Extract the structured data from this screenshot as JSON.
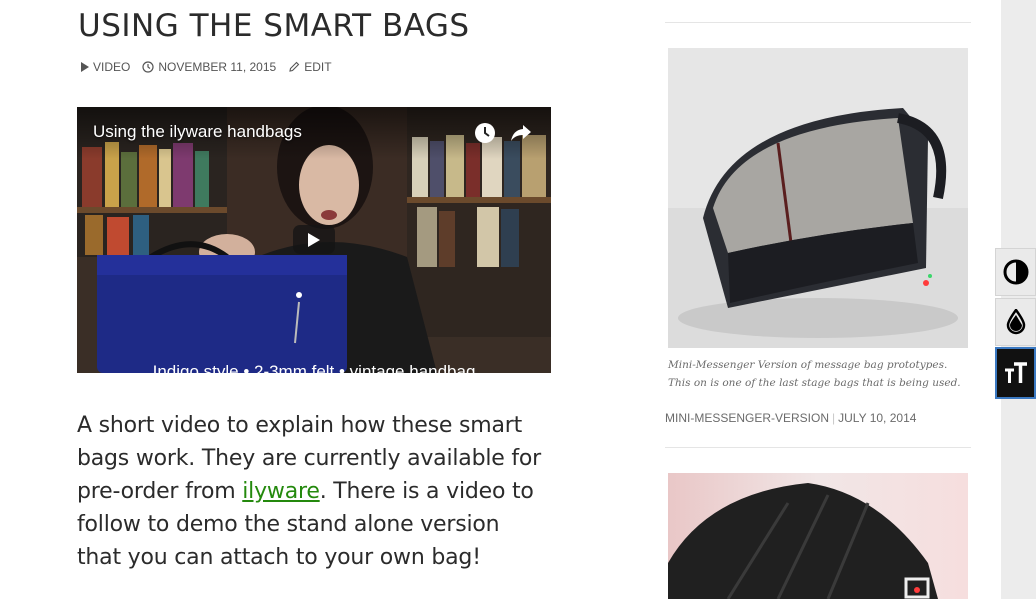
{
  "post": {
    "title": "USING THE SMART BAGS",
    "meta": {
      "format": "VIDEO",
      "date": "NOVEMBER 11, 2015",
      "edit": "EDIT"
    },
    "video": {
      "title": "Using the ilyware handbags",
      "caption": "Indigo style • 2-3mm felt • vintage handbag"
    },
    "body": {
      "before_link": "A short video to explain how these smart bags work. They are currently available for pre-order from ",
      "link_text": "ilyware",
      "after_link": ". There is a video to follow to demo the stand alone version that you can attach to your own bag!"
    }
  },
  "sidebar": {
    "post1": {
      "caption": "Mini-Messenger Version of message bag prototypes. This on is one of the last stage bags that is being used.",
      "category": "MINI-MESSENGER-VERSION",
      "separator": "|",
      "date": "JULY 10, 2014"
    }
  },
  "toolbar": {
    "buttons": [
      {
        "icon": "contrast-icon"
      },
      {
        "icon": "grayscale-drop-icon"
      },
      {
        "icon": "text-resize-icon"
      }
    ]
  },
  "colors": {
    "link": "#24890d",
    "text": "#2b2b2b",
    "meta": "#555555",
    "toolbar_active_border": "#3b79c2"
  }
}
